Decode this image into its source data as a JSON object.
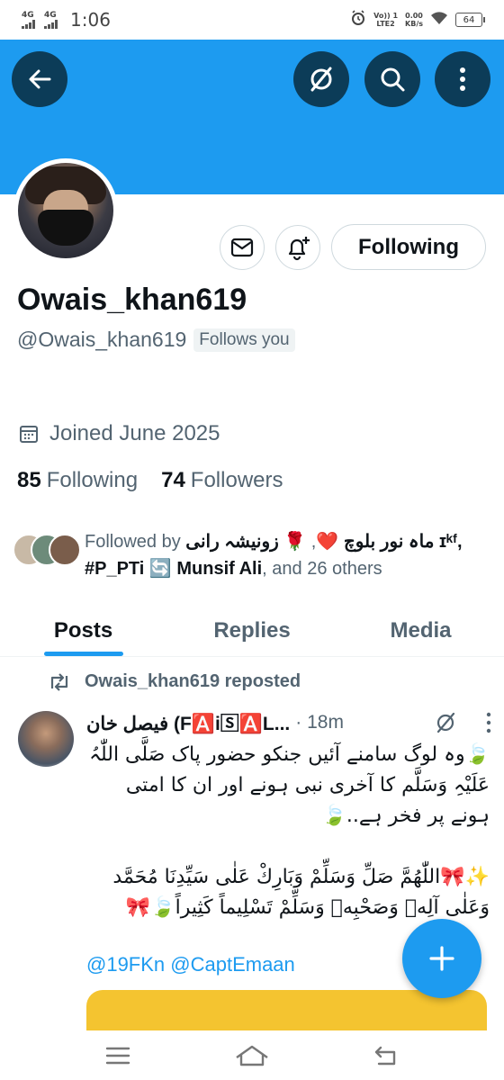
{
  "status_bar": {
    "sig1_label": "4G",
    "sig2_label": "4G",
    "time": "1:06",
    "volte_line1": "Vo)) 1",
    "volte_line2": "LTE2",
    "speed_line1": "0.00",
    "speed_line2": "KB/s",
    "battery": "64"
  },
  "profile": {
    "display_name": "Owais_khan619",
    "handle": "@Owais_khan619",
    "follows_you": "Follows you",
    "joined": "Joined June 2025",
    "following_count": "85",
    "following_label": "Following",
    "followers_count": "74",
    "followers_label": "Followers",
    "follow_button": "Following",
    "followed_by": {
      "prefix": "Followed by",
      "name1": "ماہ نور بلوچ ❤️",
      "name2": "🌹 زونیشہ رانی",
      "name3": "ɪᵏᶠ, #P_PTi 🔄 Munsif Ali",
      "suffix": ", and 26 others"
    }
  },
  "banner": {
    "color": "#1d9bf0",
    "button_color": "#0c3c58",
    "icons": [
      "back-arrow-icon",
      "no-eye-icon",
      "search-icon",
      "more-vertical-icon"
    ]
  },
  "tabs": [
    {
      "label": "Posts",
      "active": true
    },
    {
      "label": "Replies",
      "active": false
    },
    {
      "label": "Media",
      "active": false
    }
  ],
  "post": {
    "repost_label": "Owais_khan619 reposted",
    "author": "فیصل خان (F🅰️i🅂🅰️L...",
    "time": "· 18m",
    "para1": "🍃وہ لوگ سامنے آئیں جنکو حضور پاک صَلَّی اللّٰہُ عَلَیْہِ وَسَلَّم  کا آخری نبی ہونے اور ان کا امتی ہونے پر فخر ہے..🍃",
    "para2": "✨🎀اللّٰھُمَّ صَلِّ وَسَلِّمْ وَبَارِكْ عَلٰى سَيِّدِنَا مُحَمَّد وَعَلٰى آلِهٖ وَصَحْبِهٖ وَسَلِّمْ تَسْلِيماً كَثِيراً🍃🎀",
    "mentions": "@19FKn @CaptEmaan"
  },
  "colors": {
    "accent": "#1d9bf0",
    "text_primary": "#0f1419",
    "text_secondary": "#536471",
    "border": "#cfd9de",
    "media_preview": "#f4c430"
  },
  "nav_icons": [
    "menu-icon",
    "home-icon",
    "back-icon"
  ]
}
